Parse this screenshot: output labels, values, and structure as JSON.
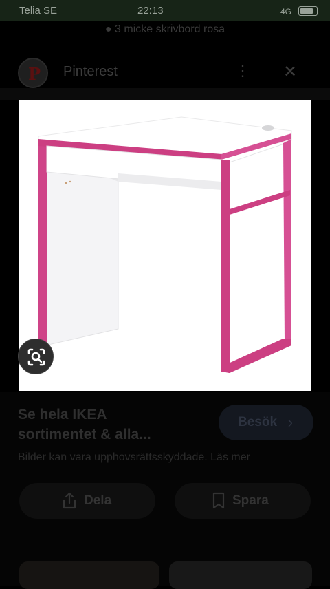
{
  "status_bar": {
    "carrier": "Telia SE",
    "time": "22:13",
    "signal": "4G"
  },
  "page_caption": "● 3 micke skrivbord rosa",
  "app_bar": {
    "app_name": "Pinterest",
    "logo_letter": "P",
    "more_icon": "more-vertical-icon",
    "close_icon": "close-icon"
  },
  "image": {
    "subject": "IKEA MICKE desk, white with pink frame",
    "colors": {
      "white": "#ffffff",
      "pink": "#cc3f82",
      "shadow": "#e6e6e8"
    }
  },
  "lens_icon": "visual-search-icon",
  "card": {
    "headline_line1": "Se hela IKEA",
    "headline_line2": "sortimentet & alla...",
    "visit_label": "Besök",
    "visit_chevron": "›",
    "disclaimer": "Bilder kan vara upphovsrättsskyddade. Läs mer",
    "share_label": "Dela",
    "save_label": "Spara"
  }
}
